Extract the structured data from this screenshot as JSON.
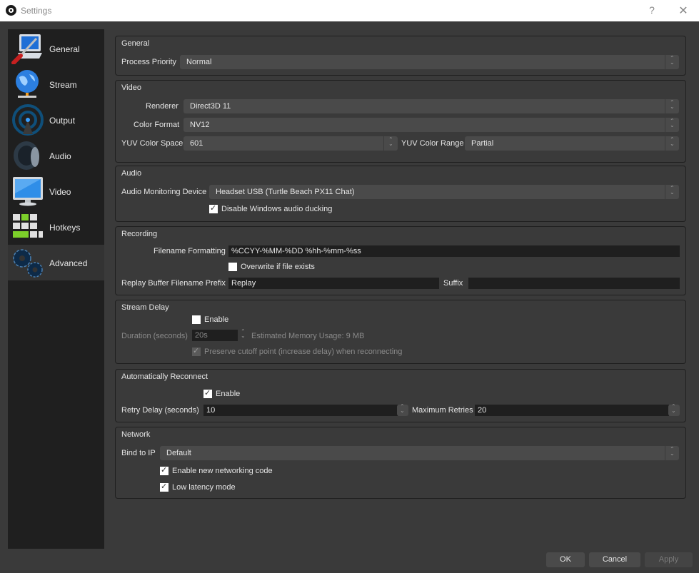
{
  "window": {
    "title": "Settings",
    "help_label": "?",
    "close_label": "✕"
  },
  "sidebar": {
    "items": [
      {
        "label": "General",
        "icon": "general-icon",
        "active": false
      },
      {
        "label": "Stream",
        "icon": "globe-icon",
        "active": false
      },
      {
        "label": "Output",
        "icon": "broadcast-icon",
        "active": false
      },
      {
        "label": "Audio",
        "icon": "speaker-icon",
        "active": false
      },
      {
        "label": "Video",
        "icon": "monitor-icon",
        "active": false
      },
      {
        "label": "Hotkeys",
        "icon": "keyboard-icon",
        "active": false
      },
      {
        "label": "Advanced",
        "icon": "gears-icon",
        "active": true
      }
    ]
  },
  "general": {
    "title": "General",
    "process_priority_label": "Process Priority",
    "process_priority_value": "Normal"
  },
  "video": {
    "title": "Video",
    "renderer_label": "Renderer",
    "renderer_value": "Direct3D 11",
    "color_format_label": "Color Format",
    "color_format_value": "NV12",
    "yuv_color_space_label": "YUV Color Space",
    "yuv_color_space_value": "601",
    "yuv_color_range_label": "YUV Color Range",
    "yuv_color_range_value": "Partial"
  },
  "audio": {
    "title": "Audio",
    "monitoring_device_label": "Audio Monitoring Device",
    "monitoring_device_value": "Headset USB (Turtle Beach PX11 Chat)",
    "disable_ducking_label": "Disable Windows audio ducking",
    "disable_ducking_checked": true
  },
  "recording": {
    "title": "Recording",
    "filename_formatting_label": "Filename Formatting",
    "filename_formatting_value": "%CCYY-%MM-%DD %hh-%mm-%ss",
    "overwrite_label": "Overwrite if file exists",
    "overwrite_checked": false,
    "replay_prefix_label": "Replay Buffer Filename Prefix",
    "replay_prefix_value": "Replay",
    "suffix_label": "Suffix",
    "suffix_value": ""
  },
  "stream_delay": {
    "title": "Stream Delay",
    "enable_label": "Enable",
    "enable_checked": false,
    "duration_label": "Duration (seconds)",
    "duration_value": "20s",
    "memory_usage_label": "Estimated Memory Usage: 9 MB",
    "preserve_label": "Preserve cutoff point (increase delay) when reconnecting",
    "preserve_checked": true
  },
  "auto_reconnect": {
    "title": "Automatically Reconnect",
    "enable_label": "Enable",
    "enable_checked": true,
    "retry_delay_label": "Retry Delay (seconds)",
    "retry_delay_value": "10",
    "max_retries_label": "Maximum Retries",
    "max_retries_value": "20"
  },
  "network": {
    "title": "Network",
    "bind_ip_label": "Bind to IP",
    "bind_ip_value": "Default",
    "new_networking_label": "Enable new networking code",
    "new_networking_checked": true,
    "low_latency_label": "Low latency mode",
    "low_latency_checked": true
  },
  "buttons": {
    "ok": "OK",
    "cancel": "Cancel",
    "apply": "Apply"
  },
  "glyphs": {
    "check": "✓"
  }
}
